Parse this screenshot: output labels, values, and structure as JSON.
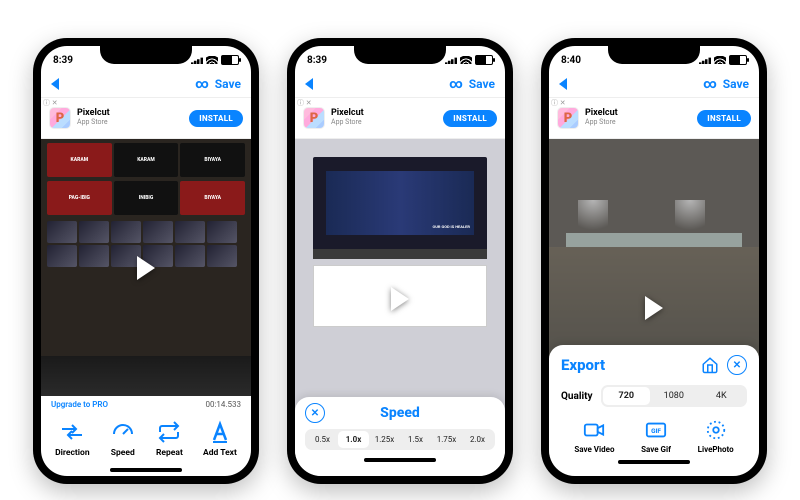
{
  "status": {
    "time_a": "8:39",
    "time_b": "8:40"
  },
  "nav": {
    "infinity": "∞",
    "save": "Save"
  },
  "ad": {
    "close": "ⓘ\n✕",
    "title": "Pixelcut",
    "sub": "App Store",
    "cta": "INSTALL"
  },
  "meta": {
    "upgrade": "Upgrade to PRO",
    "duration": "00:14.533"
  },
  "tools": {
    "direction": "Direction",
    "speed": "Speed",
    "repeat": "Repeat",
    "addtext": "Add Text"
  },
  "speed_panel": {
    "title": "Speed",
    "opts": [
      "0.5x",
      "1.0x",
      "1.25x",
      "1.5x",
      "1.75x",
      "2.0x"
    ],
    "selected": "1.0x"
  },
  "export_panel": {
    "title": "Export",
    "quality_label": "Quality",
    "quality_opts": [
      "720",
      "1080",
      "4K"
    ],
    "quality_selected": "720",
    "save_video": "Save Video",
    "save_gif": "Save Gif",
    "livephoto": "LivePhoto"
  },
  "p1_cards": [
    "KARAM",
    "KARAM",
    "BIYAYA",
    "PAG-IBIG",
    "INIBIG",
    "BIYAYA"
  ],
  "p2_overlay_text": "OUR GOD IS HEALER"
}
